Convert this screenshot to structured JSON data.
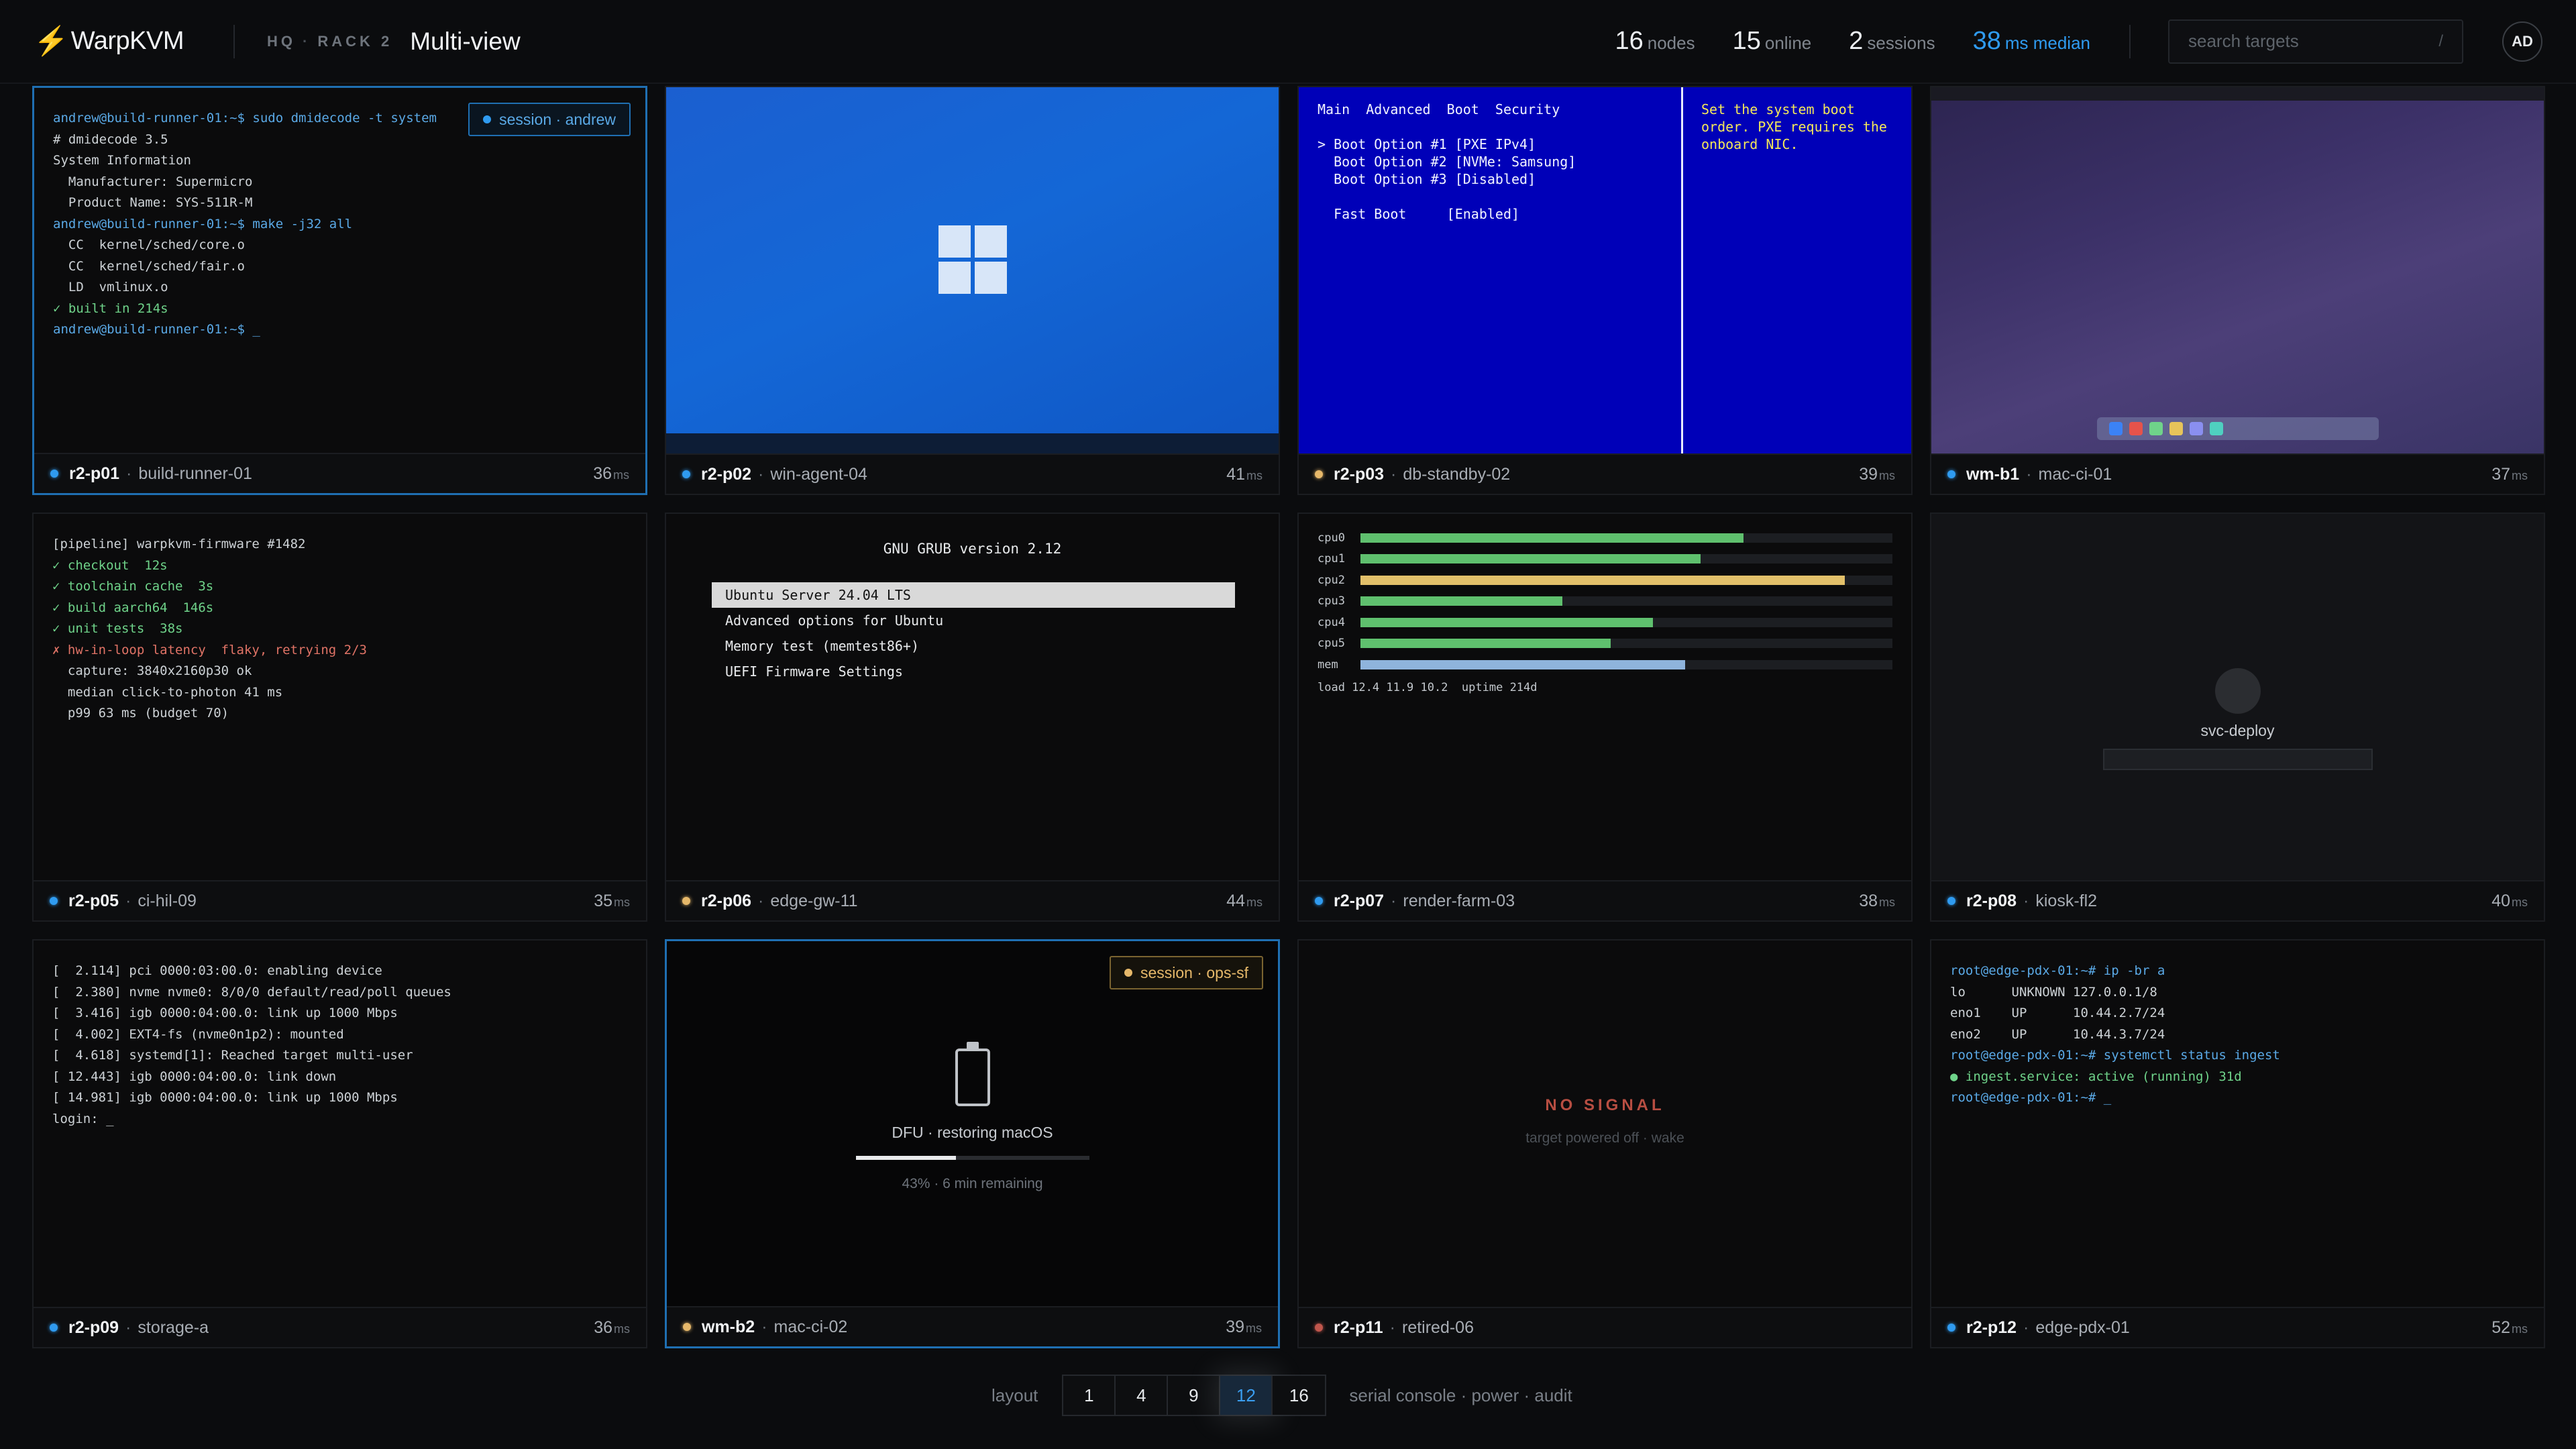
{
  "app": {
    "name": "WarpKVM",
    "logo_glyph": "⚡"
  },
  "breadcrumb": {
    "site": "HQ",
    "rack": "RACK 2"
  },
  "page_title": "Multi-view",
  "stats": {
    "nodes": {
      "value": "16",
      "label": "nodes"
    },
    "online": {
      "value": "15",
      "label": "online"
    },
    "sessions": {
      "value": "2",
      "label": "sessions"
    },
    "median": {
      "value": "38",
      "label": "ms median"
    }
  },
  "search": {
    "placeholder": "search targets",
    "shortcut": "/"
  },
  "user": {
    "initials": "AD"
  },
  "tiles": [
    {
      "id": "r2-p01",
      "host": "build-runner-01",
      "latency": "36",
      "unit": "ms",
      "status": "online",
      "badge": "session · andrew",
      "lines": [
        "andrew@build-runner-01:~$ sudo dmidecode -t system",
        "# dmidecode 3.5",
        "System Information",
        "  Manufacturer: Supermicro",
        "  Product Name: SYS-511R-M",
        "andrew@build-runner-01:~$ make -j32 all",
        "  CC  kernel/sched/core.o",
        "  CC  kernel/sched/fair.o",
        "  LD  vmlinux.o",
        "✓ built in 214s",
        "andrew@build-runner-01:~$ _"
      ]
    },
    {
      "id": "r2-p02",
      "host": "win-agent-04",
      "latency": "41",
      "unit": "ms",
      "status": "online"
    },
    {
      "id": "r2-p03",
      "host": "db-standby-02",
      "latency": "39",
      "unit": "ms",
      "status": "warning",
      "bios_menu": "Main  Advanced  Boot  Security",
      "bios_lines": [
        "> Boot Option #1 [PXE IPv4]",
        "  Boot Option #2 [NVMe: Samsung]",
        "  Boot Option #3 [Disabled]",
        "",
        "  Fast Boot     [Enabled]"
      ],
      "bios_help": "Set the system boot\norder. PXE requires the\nonboard NIC."
    },
    {
      "id": "wm-b1",
      "host": "mac-ci-01",
      "latency": "37",
      "unit": "ms",
      "status": "online",
      "dock_colors": [
        "#3b82f6",
        "#e5534b",
        "#6fd38a",
        "#e6c45a",
        "#8a8ff0",
        "#4fd0c0"
      ]
    },
    {
      "id": "r2-p05",
      "host": "ci-hil-09",
      "latency": "35",
      "unit": "ms",
      "status": "online",
      "lines": [
        "[pipeline] warpkvm-firmware #1482",
        "✓ checkout  12s",
        "✓ toolchain cache  3s",
        "✓ build aarch64  146s",
        "✓ unit tests  38s",
        "✗ hw-in-loop latency  flaky, retrying 2/3",
        "  capture: 3840x2160p30 ok",
        "  median click-to-photon 41 ms",
        "  p99 63 ms (budget 70)"
      ]
    },
    {
      "id": "r2-p06",
      "host": "edge-gw-11",
      "latency": "44",
      "unit": "ms",
      "status": "warning",
      "grub_title": "GNU GRUB version 2.12",
      "grub_items": [
        "Ubuntu Server 24.04 LTS",
        "Advanced options for Ubuntu",
        "Memory test (memtest86+)",
        "UEFI Firmware Settings"
      ]
    },
    {
      "id": "r2-p07",
      "host": "render-farm-03",
      "latency": "38",
      "unit": "ms",
      "status": "online",
      "bars": [
        {
          "label": "cpu0",
          "value": 0.72,
          "color": "#5fc06e"
        },
        {
          "label": "cpu1",
          "value": 0.64,
          "color": "#5fc06e"
        },
        {
          "label": "cpu2",
          "value": 0.91,
          "color": "#e2c06a"
        },
        {
          "label": "cpu3",
          "value": 0.38,
          "color": "#5fc06e"
        },
        {
          "label": "cpu4",
          "value": 0.55,
          "color": "#5fc06e"
        },
        {
          "label": "cpu5",
          "value": 0.47,
          "color": "#5fc06e"
        },
        {
          "label": "mem",
          "value": 0.61,
          "color": "#8fb4dc"
        }
      ],
      "load": "load 12.4 11.9 10.2  uptime 214d"
    },
    {
      "id": "r2-p08",
      "host": "kiosk-fl2",
      "latency": "40",
      "unit": "ms",
      "status": "online",
      "kiosk_label": "svc-deploy"
    },
    {
      "id": "r2-p09",
      "host": "storage-a",
      "latency": "36",
      "unit": "ms",
      "status": "online",
      "lines": [
        "[  2.114] pci 0000:03:00.0: enabling device",
        "[  2.380] nvme nvme0: 8/0/0 default/read/poll queues",
        "[  3.416] igb 0000:04:00.0: link up 1000 Mbps",
        "[  4.002] EXT4-fs (nvme0n1p2): mounted",
        "[  4.618] systemd[1]: Reached target multi-user",
        "[ 12.443] igb 0000:04:00.0: link down",
        "[ 14.981] igb 0000:04:00.0: link up 1000 Mbps",
        "login: _"
      ]
    },
    {
      "id": "wm-b2",
      "host": "mac-ci-02",
      "latency": "39",
      "unit": "ms",
      "status": "warning",
      "badge": "session · ops-sf",
      "dfu_label": "DFU · restoring macOS",
      "progress": 0.43,
      "dfu_sub": "43% · 6 min remaining"
    },
    {
      "id": "r2-p11",
      "host": "retired-06",
      "latency": "",
      "unit": "",
      "status": "offline",
      "nosig_title": "NO SIGNAL",
      "nosig_sub": "target powered off · wake"
    },
    {
      "id": "r2-p12",
      "host": "edge-pdx-01",
      "latency": "52",
      "unit": "ms",
      "status": "online",
      "lines": [
        "root@edge-pdx-01:~# ip -br a",
        "lo      UNKNOWN 127.0.0.1/8",
        "eno1    UP      10.44.2.7/24",
        "eno2    UP      10.44.3.7/24",
        "root@edge-pdx-01:~# systemctl status ingest",
        "● ingest.service: active (running) 31d",
        "root@edge-pdx-01:~# _"
      ]
    }
  ],
  "layout": {
    "label": "layout",
    "options": [
      "1",
      "4",
      "9",
      "12",
      "16"
    ],
    "selected": "12",
    "links": "serial console · power · audit"
  },
  "colors": {
    "accent": "#2f9bf0",
    "online": "#2f9bf0",
    "warning": "#e6b86a",
    "offline": "#c0564c"
  }
}
